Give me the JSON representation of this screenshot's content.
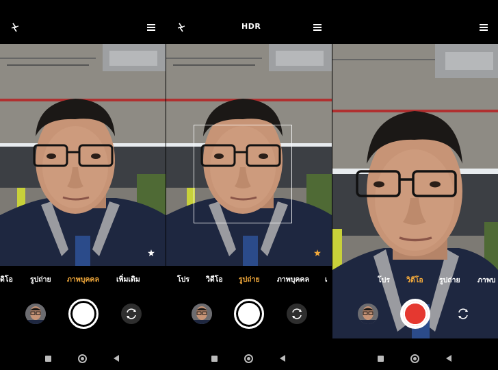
{
  "panels": [
    {
      "id": "portrait",
      "modes": [
        "ดิโอ",
        "รูปถ่าย",
        "ภาพบุคคล",
        "เพิ่มเติม"
      ],
      "active_mode": "ภาพบุคคล",
      "hdr_label": "",
      "shutter": "photo",
      "effect_icon": "white"
    },
    {
      "id": "photo",
      "modes": [
        "โปร",
        "วิดีโอ",
        "รูปถ่าย",
        "ภาพบุคคล",
        "เ"
      ],
      "active_mode": "รูปถ่าย",
      "hdr_label": "HDR",
      "shutter": "photo",
      "effect_icon": "orange"
    },
    {
      "id": "video",
      "modes": [
        "โปร",
        "วิดีโอ",
        "รูปถ่าย",
        "ภาพบ"
      ],
      "active_mode": "วิดีโอ",
      "hdr_label": "",
      "shutter": "video",
      "effect_icon": ""
    }
  ],
  "icons": {
    "flash": "flash-off-icon",
    "menu": "menu-icon",
    "flip": "camera-flip-icon"
  },
  "colors": {
    "active_mode": "#f2a93b",
    "record": "#e53830"
  }
}
